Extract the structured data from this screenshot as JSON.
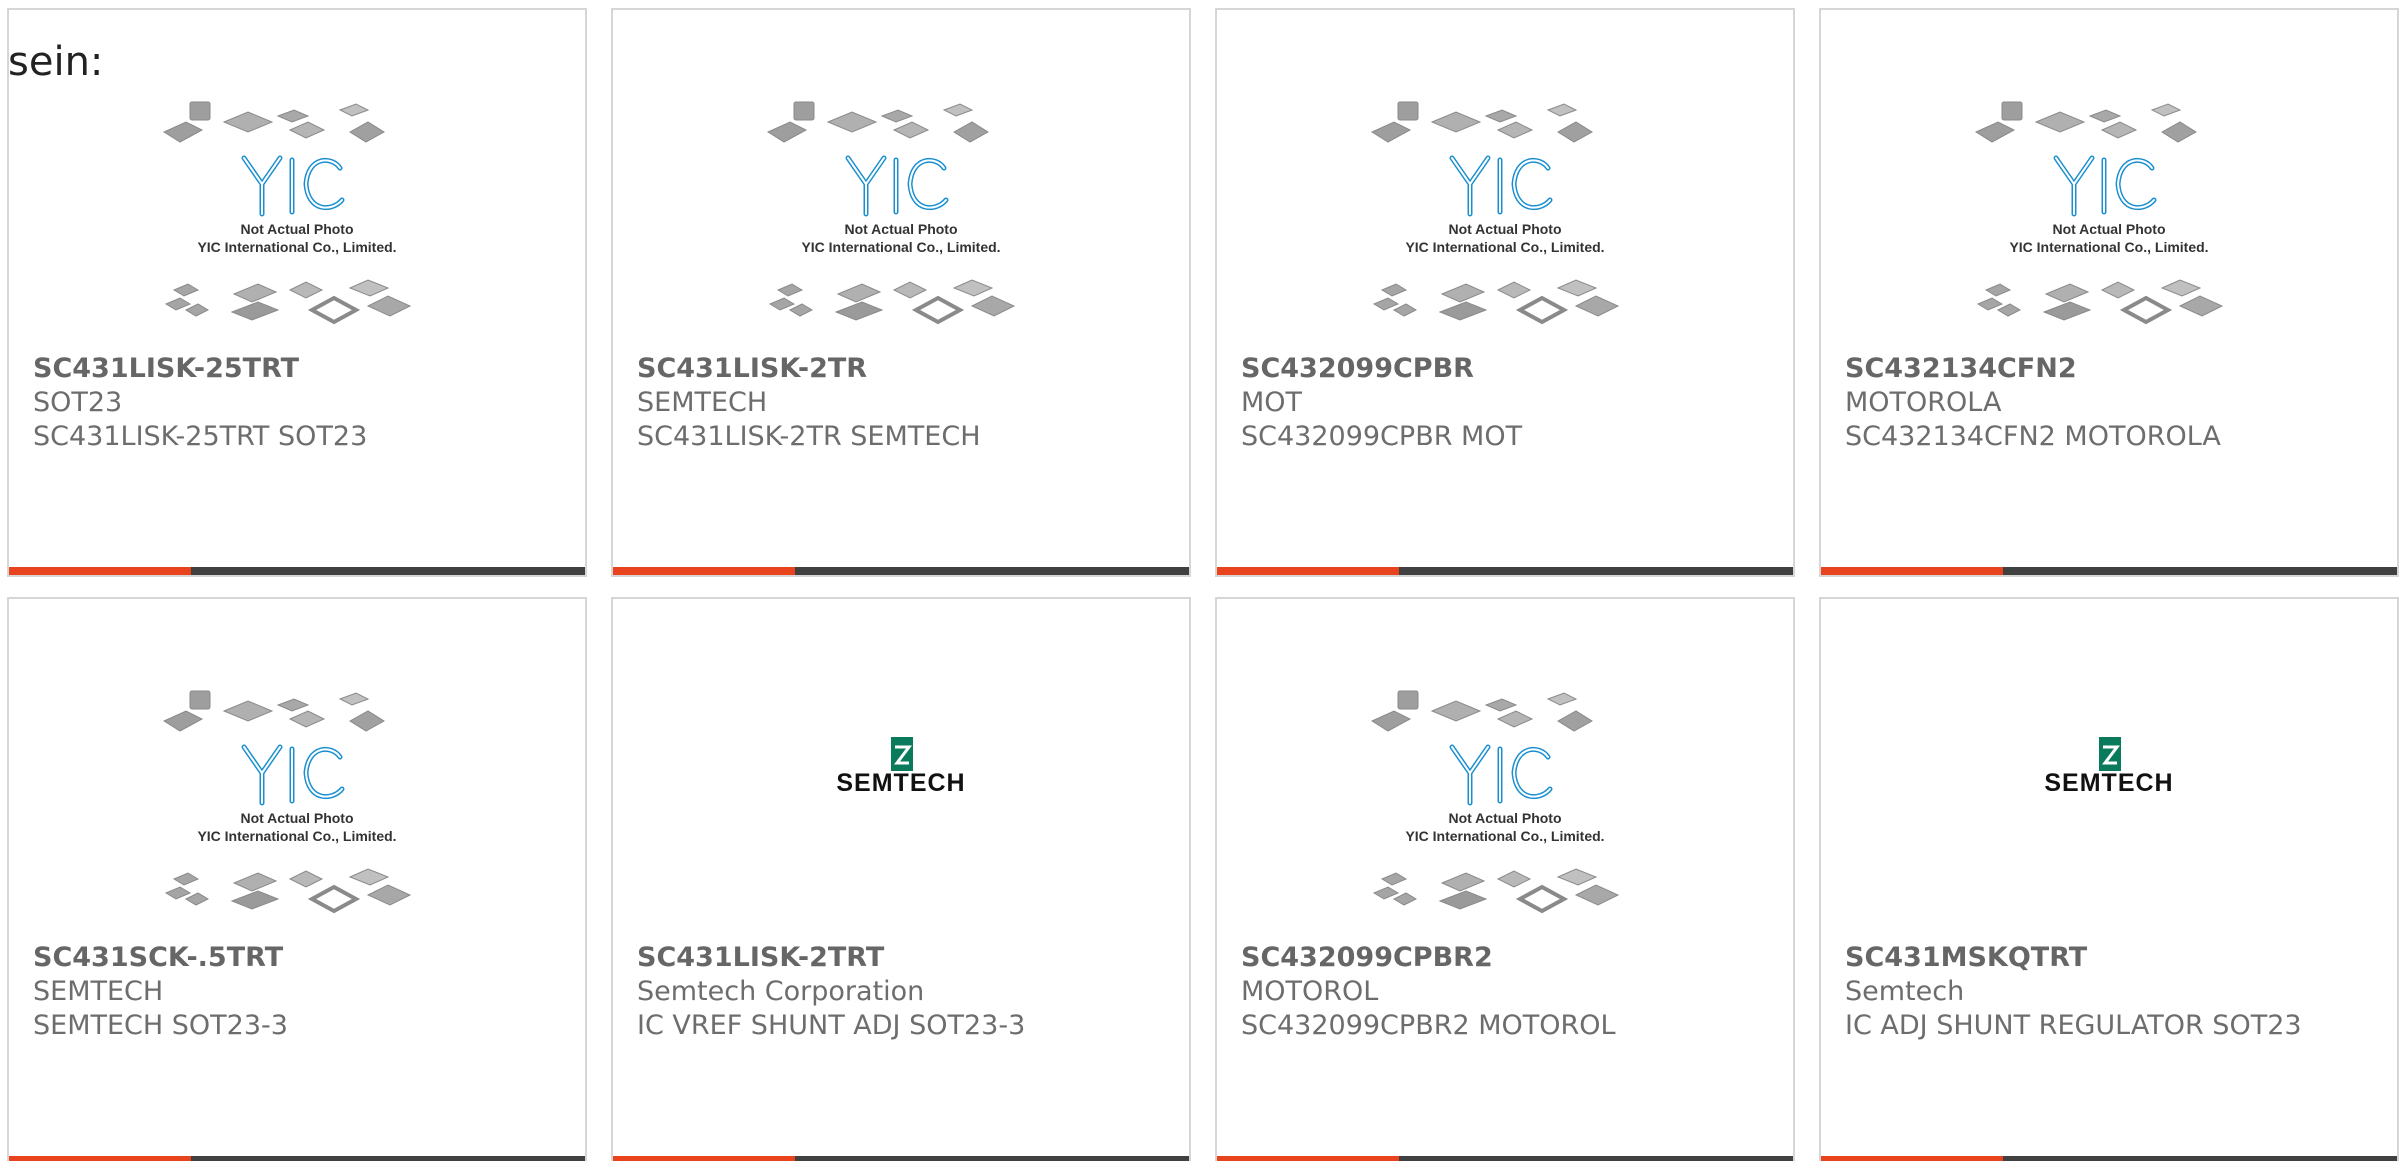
{
  "lead_text": "sein:",
  "colors": {
    "accent_bar": "#e8431c",
    "dark_bar": "#404040",
    "yic_logo": "#1a8fd0",
    "semtech_logo": "#0a7a5c",
    "text_muted": "#6d6d6d"
  },
  "placeholder": {
    "caption_line1": "Not Actual Photo",
    "caption_line2": "YIC International Co., Limited.",
    "logo_text": "YIC"
  },
  "semtech_logo_text": "SEMTECH",
  "products": [
    {
      "part_number": "SC431LISK-25TRT",
      "manufacturer": "SOT23",
      "description": "SC431LISK-25TRT SOT23",
      "image": "yic-placeholder"
    },
    {
      "part_number": "SC431LISK-2TR",
      "manufacturer": "SEMTECH",
      "description": "SC431LISK-2TR SEMTECH",
      "image": "yic-placeholder"
    },
    {
      "part_number": "SC432099CPBR",
      "manufacturer": "MOT",
      "description": "SC432099CPBR MOT",
      "image": "yic-placeholder"
    },
    {
      "part_number": "SC432134CFN2",
      "manufacturer": "MOTOROLA",
      "description": "SC432134CFN2 MOTOROLA",
      "image": "yic-placeholder"
    },
    {
      "part_number": "SC431SCK-.5TRT",
      "manufacturer": "SEMTECH",
      "description": "SEMTECH SOT23-3",
      "image": "yic-placeholder"
    },
    {
      "part_number": "SC431LISK-2TRT",
      "manufacturer": "Semtech Corporation",
      "description": "IC VREF SHUNT ADJ SOT23-3",
      "image": "semtech-logo"
    },
    {
      "part_number": "SC432099CPBR2",
      "manufacturer": "MOTOROL",
      "description": "SC432099CPBR2 MOTOROL",
      "image": "yic-placeholder"
    },
    {
      "part_number": "SC431MSKQTRT",
      "manufacturer": "Semtech",
      "description": "IC ADJ SHUNT REGULATOR SOT23",
      "image": "semtech-logo"
    }
  ]
}
